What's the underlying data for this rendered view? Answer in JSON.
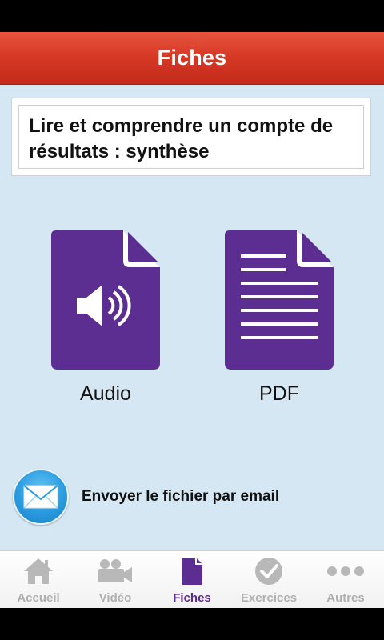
{
  "header": {
    "title": "Fiches"
  },
  "sheet": {
    "title": "Lire et comprendre un compte de résultats : synthèse"
  },
  "documents": [
    {
      "label": "Audio",
      "icon": "audio-document-icon"
    },
    {
      "label": "PDF",
      "icon": "pdf-document-icon"
    }
  ],
  "email": {
    "label": "Envoyer le fichier par email",
    "icon": "mail-icon"
  },
  "tabs": [
    {
      "label": "Accueil",
      "icon": "home-icon",
      "active": false
    },
    {
      "label": "Vidéo",
      "icon": "video-camera-icon",
      "active": false
    },
    {
      "label": "Fiches",
      "icon": "document-icon",
      "active": true
    },
    {
      "label": "Exercices",
      "icon": "checkmark-icon",
      "active": false
    },
    {
      "label": "Autres",
      "icon": "more-dots-icon",
      "active": false
    }
  ],
  "colors": {
    "header": "#d63a26",
    "accent": "#5b2a8a",
    "background": "#d6e7f4",
    "mail": "#2a9be0"
  }
}
